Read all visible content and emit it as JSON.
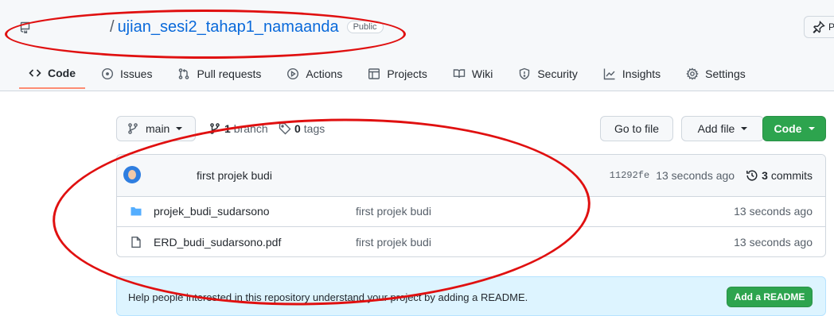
{
  "repo": {
    "name": "ujian_sesi2_tahap1_namaanda",
    "slash": "/",
    "visibility": "Public",
    "pin_label": "Pi"
  },
  "tabs": [
    {
      "label": "Code",
      "icon": "code-icon",
      "active": true
    },
    {
      "label": "Issues",
      "icon": "issue-icon"
    },
    {
      "label": "Pull requests",
      "icon": "pull-request-icon"
    },
    {
      "label": "Actions",
      "icon": "play-icon"
    },
    {
      "label": "Projects",
      "icon": "table-icon"
    },
    {
      "label": "Wiki",
      "icon": "book-icon"
    },
    {
      "label": "Security",
      "icon": "shield-icon"
    },
    {
      "label": "Insights",
      "icon": "graph-icon"
    },
    {
      "label": "Settings",
      "icon": "gear-icon"
    }
  ],
  "toolbar": {
    "branch": "main",
    "branch_count": "1",
    "branch_label": "branch",
    "tag_count": "0",
    "tag_label": "tags",
    "go_to_file": "Go to file",
    "add_file": "Add file",
    "code": "Code"
  },
  "latest_commit": {
    "message": "first projek budi",
    "sha": "11292fe",
    "age": "13 seconds ago",
    "commit_count": "3",
    "commit_label": "commits"
  },
  "files": [
    {
      "name": "projek_budi_sudarsono",
      "type": "folder",
      "message": "first projek budi",
      "age": "13 seconds ago"
    },
    {
      "name": "ERD_budi_sudarsono.pdf",
      "type": "file",
      "message": "first projek budi",
      "age": "13 seconds ago"
    }
  ],
  "readme_banner": {
    "text": "Help people interested in this repository understand your project by adding a README.",
    "button": "Add a README"
  },
  "colors": {
    "accent_green": "#2da44e",
    "link_blue": "#0969da",
    "annotation_red": "#e01010",
    "active_tab_underline": "#fd8c73"
  }
}
